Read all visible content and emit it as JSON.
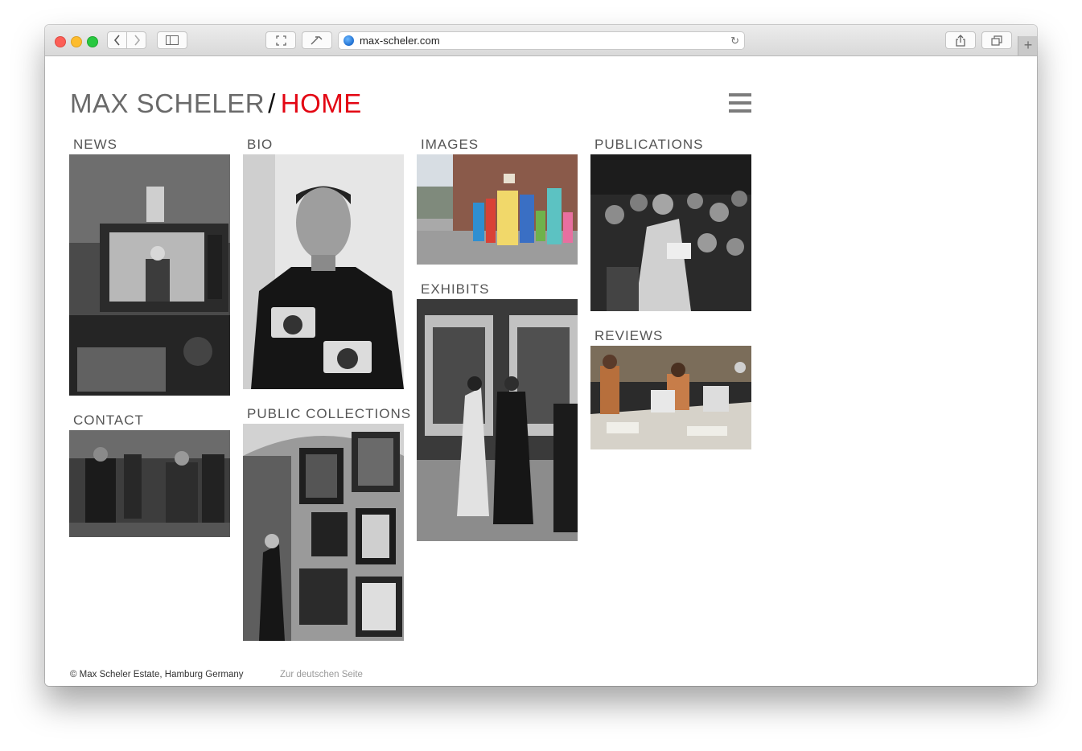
{
  "browser": {
    "url": "max-scheler.com",
    "new_tab_symbol": "+",
    "colors": {
      "close": "#fc5f57",
      "minimize": "#fdbc2e",
      "zoom": "#28c840"
    }
  },
  "header": {
    "site_name": "MAX SCHELER",
    "separator": "/",
    "current_page": "HOME",
    "colors": {
      "name": "#6a6a6a",
      "current_page": "#e30613"
    }
  },
  "tiles": {
    "news": {
      "label": "NEWS"
    },
    "bio": {
      "label": "BIO"
    },
    "images": {
      "label": "IMAGES"
    },
    "publications": {
      "label": "PUBLICATIONS"
    },
    "exhibits": {
      "label": "EXHIBITS"
    },
    "reviews": {
      "label": "REVIEWS"
    },
    "contact": {
      "label": "CONTACT"
    },
    "public_collections": {
      "label": "PUBLIC COLLECTIONS"
    }
  },
  "footer": {
    "copyright": "© Max Scheler Estate, Hamburg Germany",
    "language_link": "Zur deutschen Seite"
  }
}
